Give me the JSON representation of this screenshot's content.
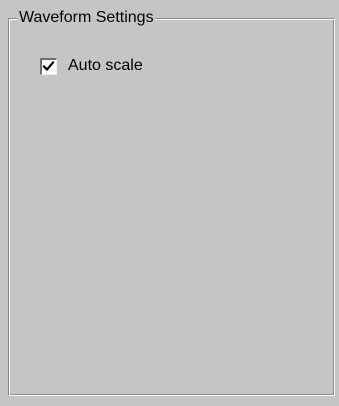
{
  "group": {
    "title": "Waveform Settings"
  },
  "auto_scale": {
    "label": "Auto scale",
    "checked": true,
    "icon": "checkmark-icon"
  }
}
